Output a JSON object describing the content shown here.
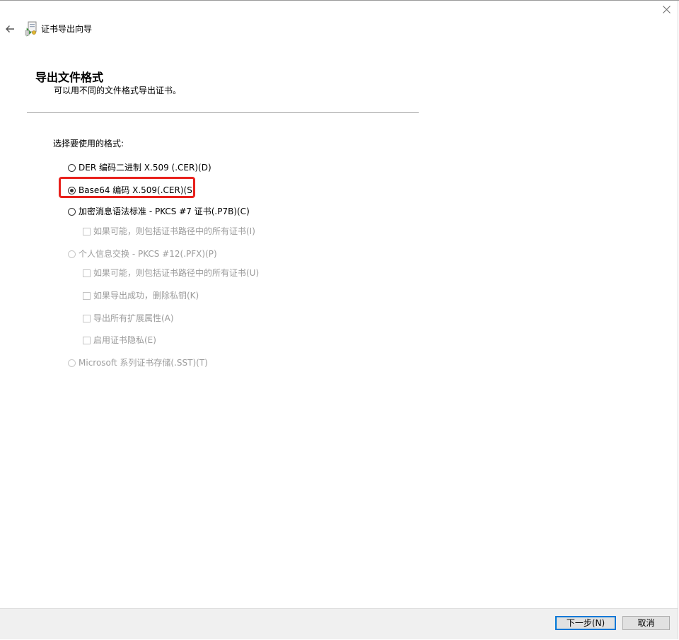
{
  "window": {
    "title": "证书导出向导"
  },
  "header": {
    "title": "导出文件格式",
    "subtitle": "可以用不同的文件格式导出证书。"
  },
  "content": {
    "format_label": "选择要使用的格式:",
    "options": [
      {
        "label": "DER 编码二进制 X.509 (.CER)(D)",
        "type": "radio",
        "checked": false,
        "enabled": true
      },
      {
        "label": "Base64 编码 X.509(.CER)(S)",
        "type": "radio",
        "checked": true,
        "enabled": true
      },
      {
        "label": "加密消息语法标准 - PKCS #7 证书(.P7B)(C)",
        "type": "radio",
        "checked": false,
        "enabled": true
      },
      {
        "label": "如果可能，则包括证书路径中的所有证书(I)",
        "type": "checkbox",
        "checked": false,
        "enabled": false
      },
      {
        "label": "个人信息交换 - PKCS #12(.PFX)(P)",
        "type": "radio",
        "checked": false,
        "enabled": false
      },
      {
        "label": "如果可能，则包括证书路径中的所有证书(U)",
        "type": "checkbox",
        "checked": false,
        "enabled": false
      },
      {
        "label": "如果导出成功，删除私钥(K)",
        "type": "checkbox",
        "checked": false,
        "enabled": false
      },
      {
        "label": "导出所有扩展属性(A)",
        "type": "checkbox",
        "checked": false,
        "enabled": false
      },
      {
        "label": "启用证书隐私(E)",
        "type": "checkbox",
        "checked": false,
        "enabled": false
      },
      {
        "label": "Microsoft 系列证书存储(.SST)(T)",
        "type": "radio",
        "checked": false,
        "enabled": false
      }
    ]
  },
  "footer": {
    "next_label": "下一步(N)",
    "cancel_label": "取消"
  },
  "colors": {
    "highlight": "#e8211c",
    "primary_border": "#0078d7",
    "disabled_text": "#9c9c9c",
    "footer_bg": "#f0f0f0"
  }
}
